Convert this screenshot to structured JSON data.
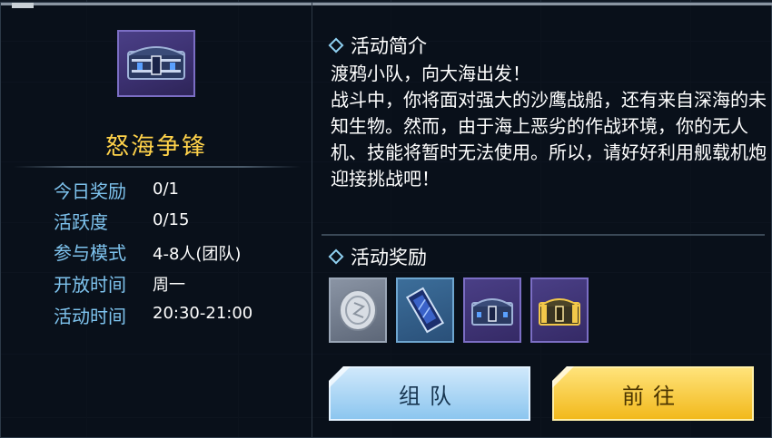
{
  "activity": {
    "title": "怒海争锋",
    "icon": "treasure-chest-icon"
  },
  "info": {
    "rows": [
      {
        "label": "今日奖励",
        "value": "0/1"
      },
      {
        "label": "活跃度",
        "value": "0/15"
      },
      {
        "label": "参与模式",
        "value": "4-8人(团队)"
      },
      {
        "label": "开放时间",
        "value": "周一"
      },
      {
        "label": "活动时间",
        "value": "20:30-21:00"
      }
    ]
  },
  "intro": {
    "heading": "活动简介",
    "line1": "渡鸦小队，向大海出发！",
    "line2": "战斗中，你将面对强大的沙鹰战船，还有来自深海的未知生物。然而，由于海上恶劣的作战环境，你的无人机、技能将暂时无法使用。所以，请好好利用舰载机炮迎接挑战吧！"
  },
  "rewards": {
    "heading": "活动奖励",
    "items": [
      "silver-coin-icon",
      "blueprint-card-icon",
      "treasure-chest-icon",
      "gold-chest-icon"
    ]
  },
  "buttons": {
    "team": "组队",
    "go": "前往"
  },
  "colors": {
    "title_gold": "#ffd24a",
    "label_blue": "#7ec3ee",
    "team_button": "#a8d6f6",
    "go_button": "#f7c52b"
  }
}
